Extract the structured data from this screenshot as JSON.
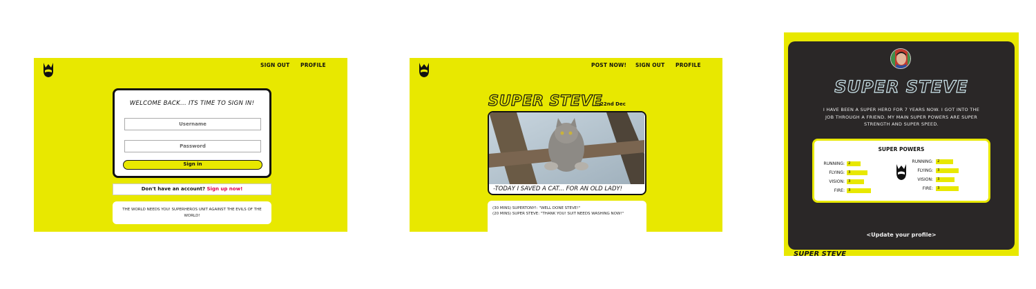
{
  "colors": {
    "brand_yellow": "#e8e800",
    "dark_card": "#2a2727",
    "signup_link": "#e0004d"
  },
  "login_screen": {
    "nav": {
      "sign_out": "SIGN OUT",
      "profile": "PROFILE"
    },
    "title": "WELCOME BACK... ITS TIME TO SIGN IN!",
    "username_placeholder": "Username",
    "password_placeholder": "Password",
    "signin_label": "Sign in",
    "no_account_text": "Don't have an account?",
    "signup_link": "Sign up now!",
    "tagline": "THE WORLD NEEDS YOU! SUPERHEROS UNIT AGAINST THE EVILS OF THE WORLD!"
  },
  "post_screen": {
    "nav": {
      "post_now": "POST NOW!",
      "sign_out": "SIGN OUT",
      "profile": "PROFILE"
    },
    "hero_name": "SUPER STEVE",
    "date": "...22nd Dec",
    "caption": "-TODAY I SAVED A CAT... FOR AN OLD LADY!",
    "comments": [
      "(30 MINS) SUPERTONY!:  \"WELL DONE STEVE!\"",
      "(20 MINS) SUPER STEVE: \"THANK YOU! SUIT NEEDS WASHING NOW!\""
    ]
  },
  "profile_screen": {
    "name": "SUPER STEVE",
    "bio": "I HAVE BEEN A SUPER HERO FOR 7 YEARS NOW. I GOT INTO THE JOB THROUGH A FRIEND. MY MAIN SUPER POWERS ARE SUPER STRENGTH AND SUPER SPEED.",
    "powers_title": "SUPER POWERS",
    "powers_left": [
      {
        "label": "RUNNING:",
        "value": "2"
      },
      {
        "label": "FLYING:",
        "value": "3"
      },
      {
        "label": "VISION:",
        "value": "3"
      },
      {
        "label": "FIRE:",
        "value": "3"
      }
    ],
    "powers_right": [
      {
        "label": "RUNNING:",
        "value": "2"
      },
      {
        "label": "FLYING:",
        "value": "3"
      },
      {
        "label": "VISION:",
        "value": "3"
      },
      {
        "label": "FIRE:",
        "value": "3"
      }
    ],
    "update_link": "<Update your profile>",
    "footer_peek": "SUPER STEVE"
  }
}
